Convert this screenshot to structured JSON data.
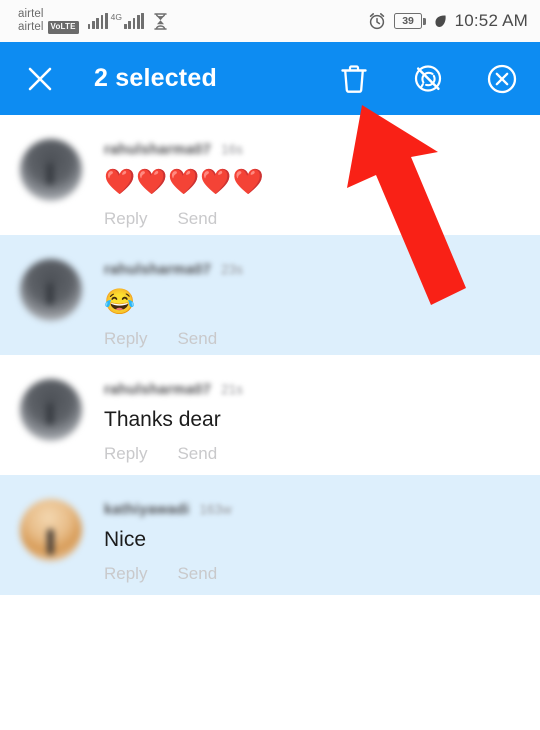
{
  "status_bar": {
    "carrier_line_1": "airtel",
    "carrier_line_2": "airtel",
    "volte_badge": "VoLTE",
    "network_type": "4G",
    "signal_icon": "signal-bars-icon",
    "hourglass_icon": "hourglass-icon",
    "alarm_icon": "alarm-clock-icon",
    "battery_percent": "39",
    "eco_icon": "leaf-icon",
    "time": "10:52 AM"
  },
  "app_bar": {
    "close_icon": "close-x-icon",
    "title": "2 selected",
    "selected_count": 2,
    "background_color": "#0d8cf2",
    "actions": [
      {
        "name": "delete-button",
        "icon": "trash-icon",
        "label": "Delete"
      },
      {
        "name": "hide-comment-button",
        "icon": "comment-hidden-icon",
        "label": "Hide"
      },
      {
        "name": "block-user-button",
        "icon": "circle-x-icon",
        "label": "Block"
      }
    ]
  },
  "comments": [
    {
      "username": "rahulsharma07",
      "timestamp": "16s",
      "text": "❤️❤️❤️❤️❤️",
      "is_emoji": true,
      "selected": false,
      "avatar_tone": "dark",
      "reply_label": "Reply",
      "send_label": "Send"
    },
    {
      "username": "rahulsharma07",
      "timestamp": "23s",
      "text": "😂",
      "is_emoji": true,
      "selected": true,
      "avatar_tone": "dark",
      "reply_label": "Reply",
      "send_label": "Send"
    },
    {
      "username": "rahulsharma07",
      "timestamp": "21s",
      "text": "Thanks dear",
      "is_emoji": false,
      "selected": false,
      "avatar_tone": "dark",
      "reply_label": "Reply",
      "send_label": "Send"
    },
    {
      "username": "kathiyawadi",
      "timestamp": "163w",
      "text": "Nice",
      "is_emoji": false,
      "selected": true,
      "avatar_tone": "warm",
      "reply_label": "Reply",
      "send_label": "Send"
    }
  ],
  "annotation": {
    "arrow_icon": "red-arrow-up-left",
    "color": "#f92116",
    "points_to": "delete-button"
  },
  "colors": {
    "accent": "#0d8cf2",
    "selected_row": "#ddeffc",
    "row": "#ffffff",
    "action_link": "#c9c9cb"
  }
}
